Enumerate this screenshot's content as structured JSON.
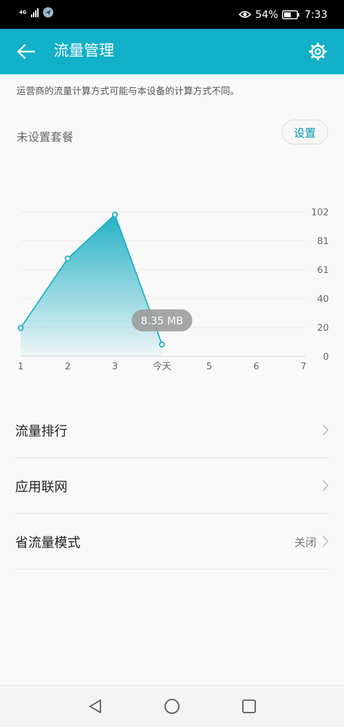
{
  "status_bar": {
    "network_type": "4G",
    "battery_percent": "54%",
    "battery_level": 0.54,
    "time": "7:33",
    "icons": [
      "signal-icon",
      "app-notification-icon",
      "eye-comfort-icon",
      "battery-icon"
    ]
  },
  "app_bar": {
    "title": "流量管理",
    "back_icon": "arrow-left-icon",
    "settings_icon": "gear-icon"
  },
  "notice": "运营商的流量计算方式可能与本设备的计算方式不同。",
  "plan": {
    "label": "未设置套餐",
    "set_button": "设置"
  },
  "chart_data": {
    "type": "area",
    "x_labels": [
      "1",
      "2",
      "3",
      "今天",
      "5",
      "6",
      "7"
    ],
    "values": [
      20,
      69,
      100,
      8.35
    ],
    "y_ticks": [
      "0",
      "20",
      "40",
      "61",
      "81",
      "102"
    ],
    "ylim": [
      0,
      102
    ],
    "tooltip": "8.35 MB",
    "grid": true,
    "accent_color": "#1aaec3"
  },
  "menu": {
    "items": [
      {
        "label": "流量排行",
        "value": ""
      },
      {
        "label": "应用联网",
        "value": ""
      },
      {
        "label": "省流量模式",
        "value": "关闭"
      }
    ]
  },
  "nav_bar": {
    "icons": [
      "back-triangle-icon",
      "home-circle-icon",
      "recents-square-icon"
    ]
  }
}
